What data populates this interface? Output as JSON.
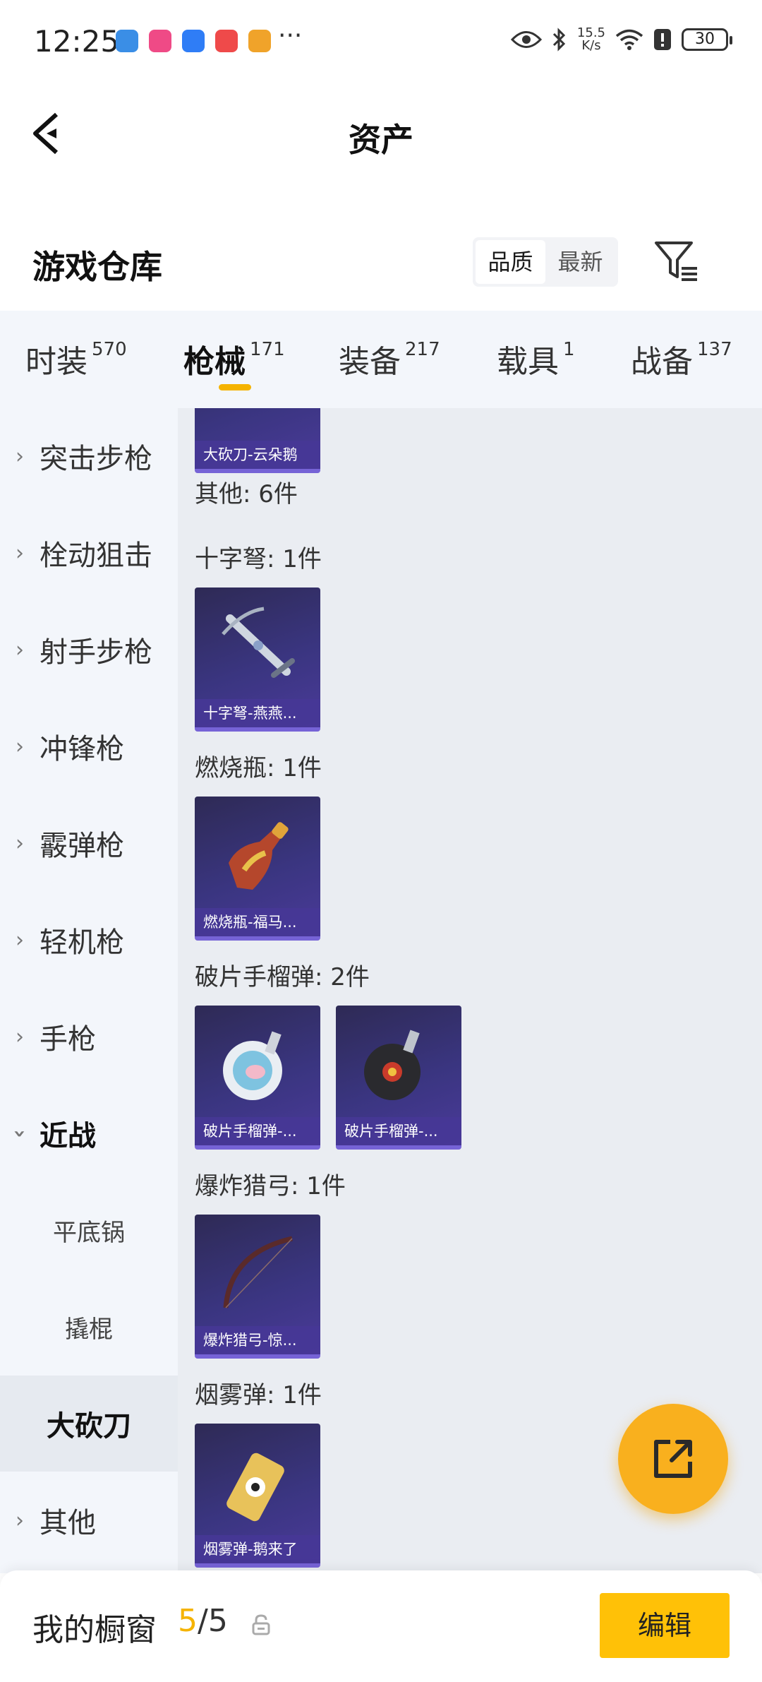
{
  "status_bar": {
    "time": "12:25",
    "more": "···",
    "net_speed": "15.5\nK/s",
    "battery": "30",
    "app_colors": [
      "#3a8ee6",
      "#ef4a86",
      "#2f7df6",
      "#ef4a4a",
      "#f0a32a"
    ]
  },
  "header": {
    "title": "资产"
  },
  "warehouse": {
    "title": "游戏仓库",
    "sort_options": [
      "品质",
      "最新"
    ]
  },
  "tabs": [
    {
      "label": "时装",
      "count": "570"
    },
    {
      "label": "枪械",
      "count": "171"
    },
    {
      "label": "装备",
      "count": "217"
    },
    {
      "label": "载具",
      "count": "1"
    },
    {
      "label": "战备",
      "count": "137"
    }
  ],
  "sidebar": {
    "items": [
      {
        "label": "突击步枪"
      },
      {
        "label": "栓动狙击"
      },
      {
        "label": "射手步枪"
      },
      {
        "label": "冲锋枪"
      },
      {
        "label": "霰弹枪"
      },
      {
        "label": "轻机枪"
      },
      {
        "label": "手枪"
      },
      {
        "label": "近战"
      },
      {
        "label": "平底锅"
      },
      {
        "label": "撬棍"
      },
      {
        "label": "大砍刀"
      },
      {
        "label": "其他"
      }
    ]
  },
  "content": {
    "top_card": "大砍刀-云朵鹅",
    "other_header": "其他: 6件",
    "groups": [
      {
        "title": "十字弩: 1件",
        "items": [
          "十字弩-燕燕..."
        ]
      },
      {
        "title": "燃烧瓶: 1件",
        "items": [
          "燃烧瓶-福马..."
        ]
      },
      {
        "title": "破片手榴弹: 2件",
        "items": [
          "破片手榴弹-...",
          "破片手榴弹-..."
        ]
      },
      {
        "title": "爆炸猎弓: 1件",
        "items": [
          "爆炸猎弓-惊..."
        ]
      },
      {
        "title": "烟雾弹: 1件",
        "items": [
          "烟雾弹-鹅来了"
        ]
      }
    ]
  },
  "bottom_bar": {
    "title": "我的橱窗",
    "count_current": "5",
    "count_sep_total": "/5",
    "edit_label": "编辑"
  },
  "colors": {
    "accent": "#f5b300",
    "card": "#3a3580",
    "fab": "#f9b01e"
  }
}
